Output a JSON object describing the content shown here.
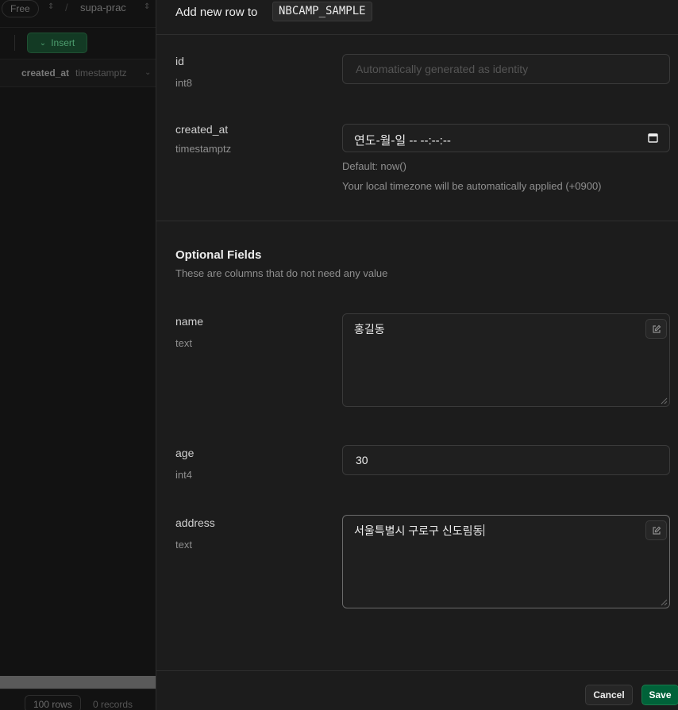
{
  "background": {
    "plan_badge": "Free",
    "project_name": "supa-prac",
    "insert_label": "Insert",
    "column_name": "created_at",
    "column_type": "timestamptz",
    "rows_count": "100 rows",
    "records_count": "0 records"
  },
  "panel": {
    "title_prefix": "Add new row to",
    "table_name": "NBCAMP_SAMPLE",
    "fields": {
      "id": {
        "label": "id",
        "type": "int8",
        "placeholder": "Automatically generated as identity"
      },
      "created_at": {
        "label": "created_at",
        "type": "timestamptz",
        "value": "연도-월-일 -- --:--:--",
        "default_hint": "Default: now()",
        "timezone_hint": "Your local timezone will be automatically applied (+0900)"
      }
    },
    "optional": {
      "title": "Optional Fields",
      "subtitle": "These are columns that do not need any value",
      "name": {
        "label": "name",
        "type": "text",
        "value": "홍길동"
      },
      "age": {
        "label": "age",
        "type": "int4",
        "value": "30"
      },
      "address": {
        "label": "address",
        "type": "text",
        "value": "서울특별시 구로구 신도림동"
      }
    },
    "footer": {
      "cancel_label": "Cancel",
      "save_label": "Save"
    }
  }
}
